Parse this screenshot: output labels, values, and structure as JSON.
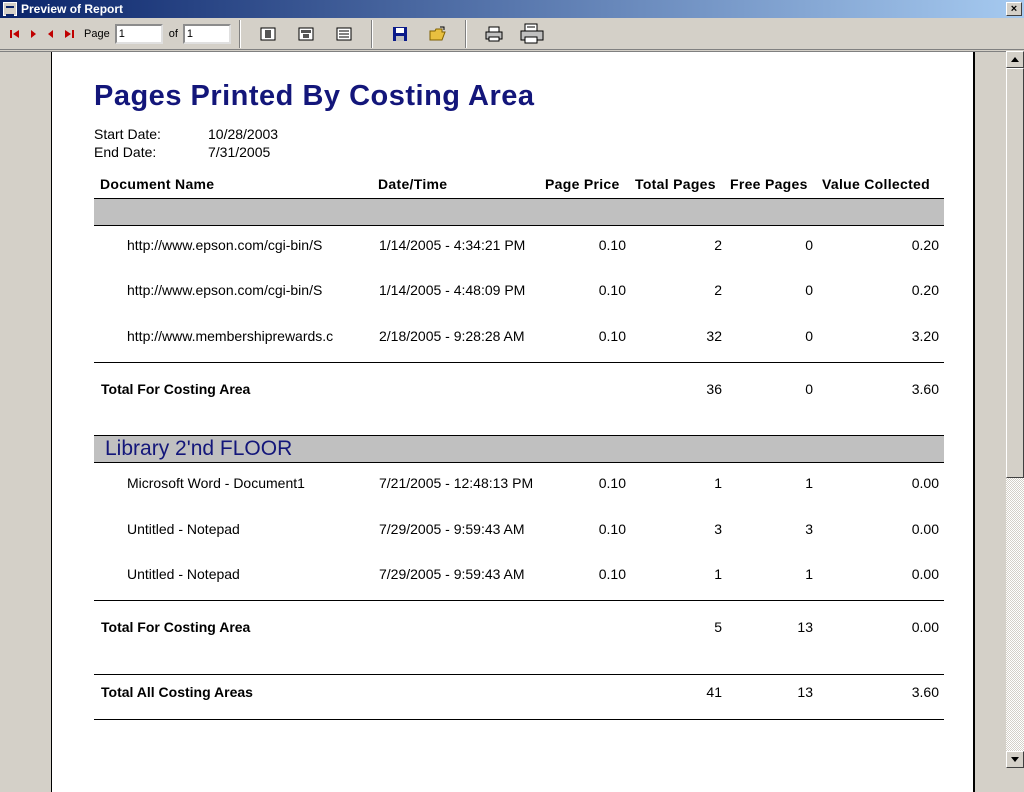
{
  "window": {
    "title": "Preview of Report",
    "close": "×"
  },
  "toolbar": {
    "page_label": "Page",
    "page_value": "1",
    "of_label": "of",
    "total_pages": "1"
  },
  "report": {
    "title": "Pages Printed By Costing Area",
    "start_label": "Start Date:",
    "start_value": "10/28/2003",
    "end_label": "End Date:",
    "end_value": "7/31/2005",
    "columns": [
      "Document Name",
      "Date/Time",
      "Page Price",
      "Total Pages",
      "Free Pages",
      "Value Collected"
    ],
    "groups": [
      {
        "name": "",
        "rows": [
          {
            "doc": "http://www.epson.com/cgi-bin/S",
            "date": "1/14/2005 - 4:34:21 PM",
            "price": "0.10",
            "total": "2",
            "free": "0",
            "value": "0.20"
          },
          {
            "doc": "http://www.epson.com/cgi-bin/S",
            "date": "1/14/2005 - 4:48:09 PM",
            "price": "0.10",
            "total": "2",
            "free": "0",
            "value": "0.20"
          },
          {
            "doc": "http://www.membershiprewards.c",
            "date": "2/18/2005 - 9:28:28 AM",
            "price": "0.10",
            "total": "32",
            "free": "0",
            "value": "3.20"
          }
        ],
        "total": {
          "label": "Total For Costing Area",
          "total": "36",
          "free": "0",
          "value": "3.60"
        }
      },
      {
        "name": "Library 2'nd FLOOR",
        "rows": [
          {
            "doc": "Microsoft Word - Document1",
            "date": "7/21/2005 - 12:48:13 PM",
            "price": "0.10",
            "total": "1",
            "free": "1",
            "value": "0.00"
          },
          {
            "doc": "Untitled - Notepad",
            "date": "7/29/2005 - 9:59:43 AM",
            "price": "0.10",
            "total": "3",
            "free": "3",
            "value": "0.00"
          },
          {
            "doc": "Untitled - Notepad",
            "date": "7/29/2005 - 9:59:43 AM",
            "price": "0.10",
            "total": "1",
            "free": "1",
            "value": "0.00"
          }
        ],
        "total": {
          "label": "Total For Costing Area",
          "total": "5",
          "free": "13",
          "value": "0.00"
        }
      }
    ],
    "grand_total": {
      "label": "Total All Costing Areas",
      "total": "41",
      "free": "13",
      "value": "3.60"
    }
  }
}
